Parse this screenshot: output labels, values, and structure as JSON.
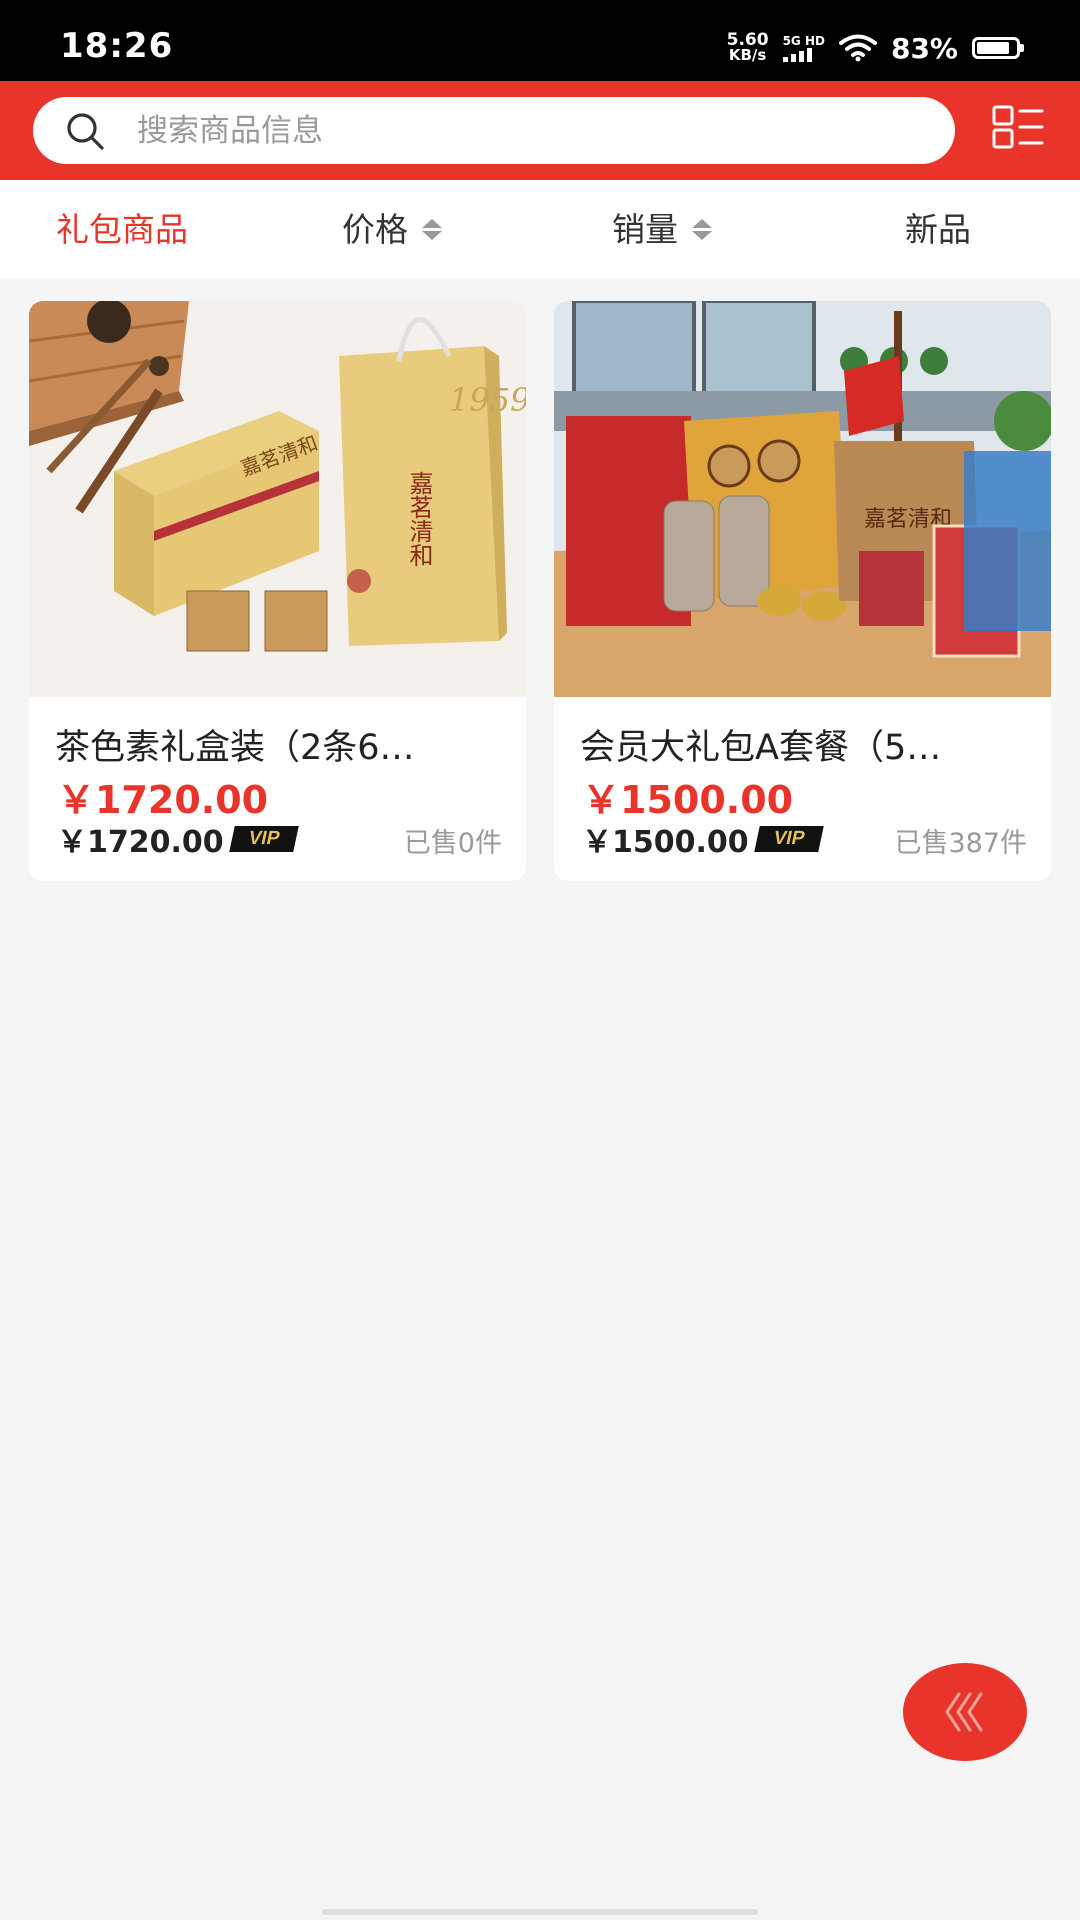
{
  "status_bar": {
    "time": "18:26",
    "net_speed": "5.60",
    "net_unit": "KB/s",
    "network_type": "5G HD",
    "battery_percent": "83%"
  },
  "search": {
    "placeholder": "搜索商品信息"
  },
  "tabs": [
    {
      "label": "礼包商品",
      "active": true
    },
    {
      "label": "价格",
      "sortable": true
    },
    {
      "label": "销量",
      "sortable": true
    },
    {
      "label": "新品"
    }
  ],
  "products": [
    {
      "title": "茶色素礼盒装（2条6…",
      "price": "￥1720.00",
      "vip_price": "￥1720.00",
      "vip_label": "VIP",
      "sold": "已售0件"
    },
    {
      "title": "会员大礼包A套餐（5…",
      "price": "￥1500.00",
      "vip_price": "￥1500.00",
      "vip_label": "VIP",
      "sold": "已售387件"
    }
  ],
  "colors": {
    "brand_red": "#e8342a",
    "background": "#f5f5f5"
  },
  "icons": [
    "search-icon",
    "list-layout-icon",
    "back-arrows-icon",
    "wifi-icon",
    "battery-icon"
  ]
}
